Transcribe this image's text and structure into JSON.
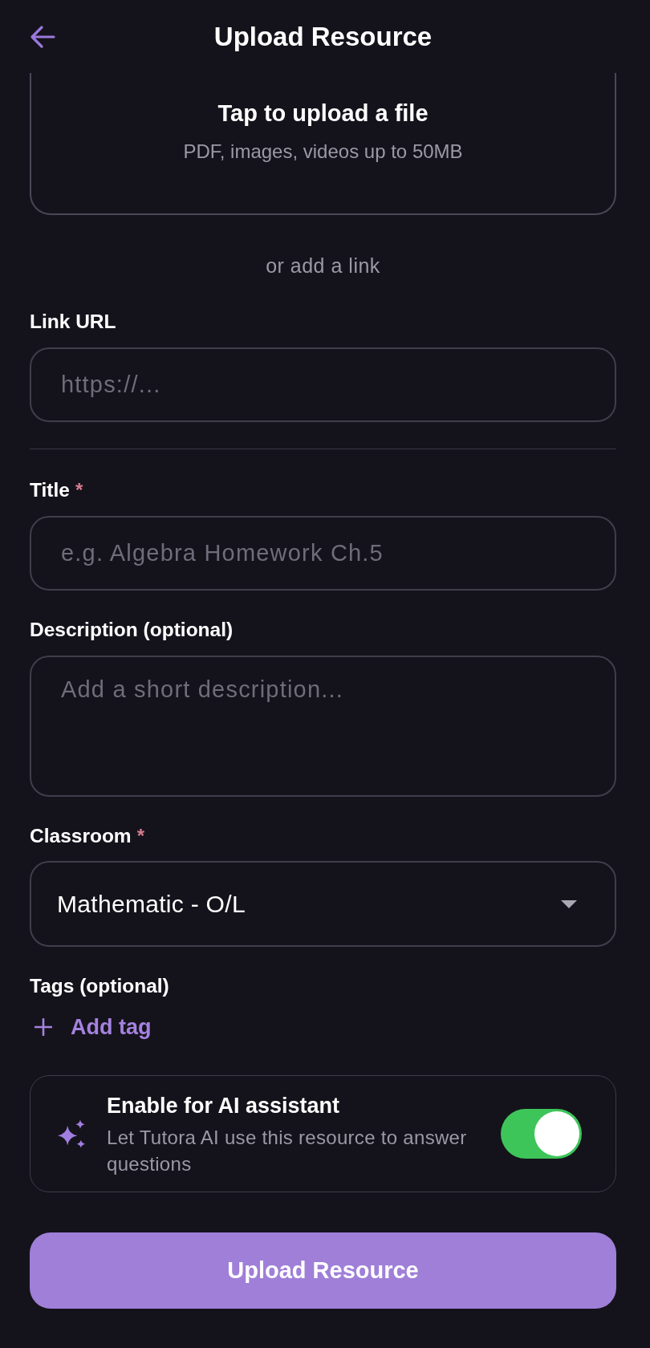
{
  "header": {
    "title": "Upload Resource"
  },
  "upload_area": {
    "title": "Tap to upload a file",
    "hint": "PDF, images, videos up to 50MB"
  },
  "separator_text": "or add a link",
  "link_field": {
    "label": "Link URL",
    "placeholder": "https://..."
  },
  "fields": [
    {
      "kind": "text",
      "label": "Title",
      "required_mark": "*",
      "placeholder": "e.g. Algebra Homework Ch.5"
    },
    {
      "kind": "textarea",
      "label": "Description (optional)",
      "placeholder": "Add a short description..."
    },
    {
      "kind": "select",
      "label": "Classroom",
      "required_mark": "*",
      "value": "Mathematic - O/L"
    },
    {
      "kind": "tags",
      "label": "Tags (optional)",
      "action": "Add tag"
    }
  ],
  "ai_assistant": {
    "title": "Enable for AI assistant",
    "description": "Let Tutora AI use this resource to answer questions",
    "enabled": true
  },
  "submit_button": "Upload Resource"
}
